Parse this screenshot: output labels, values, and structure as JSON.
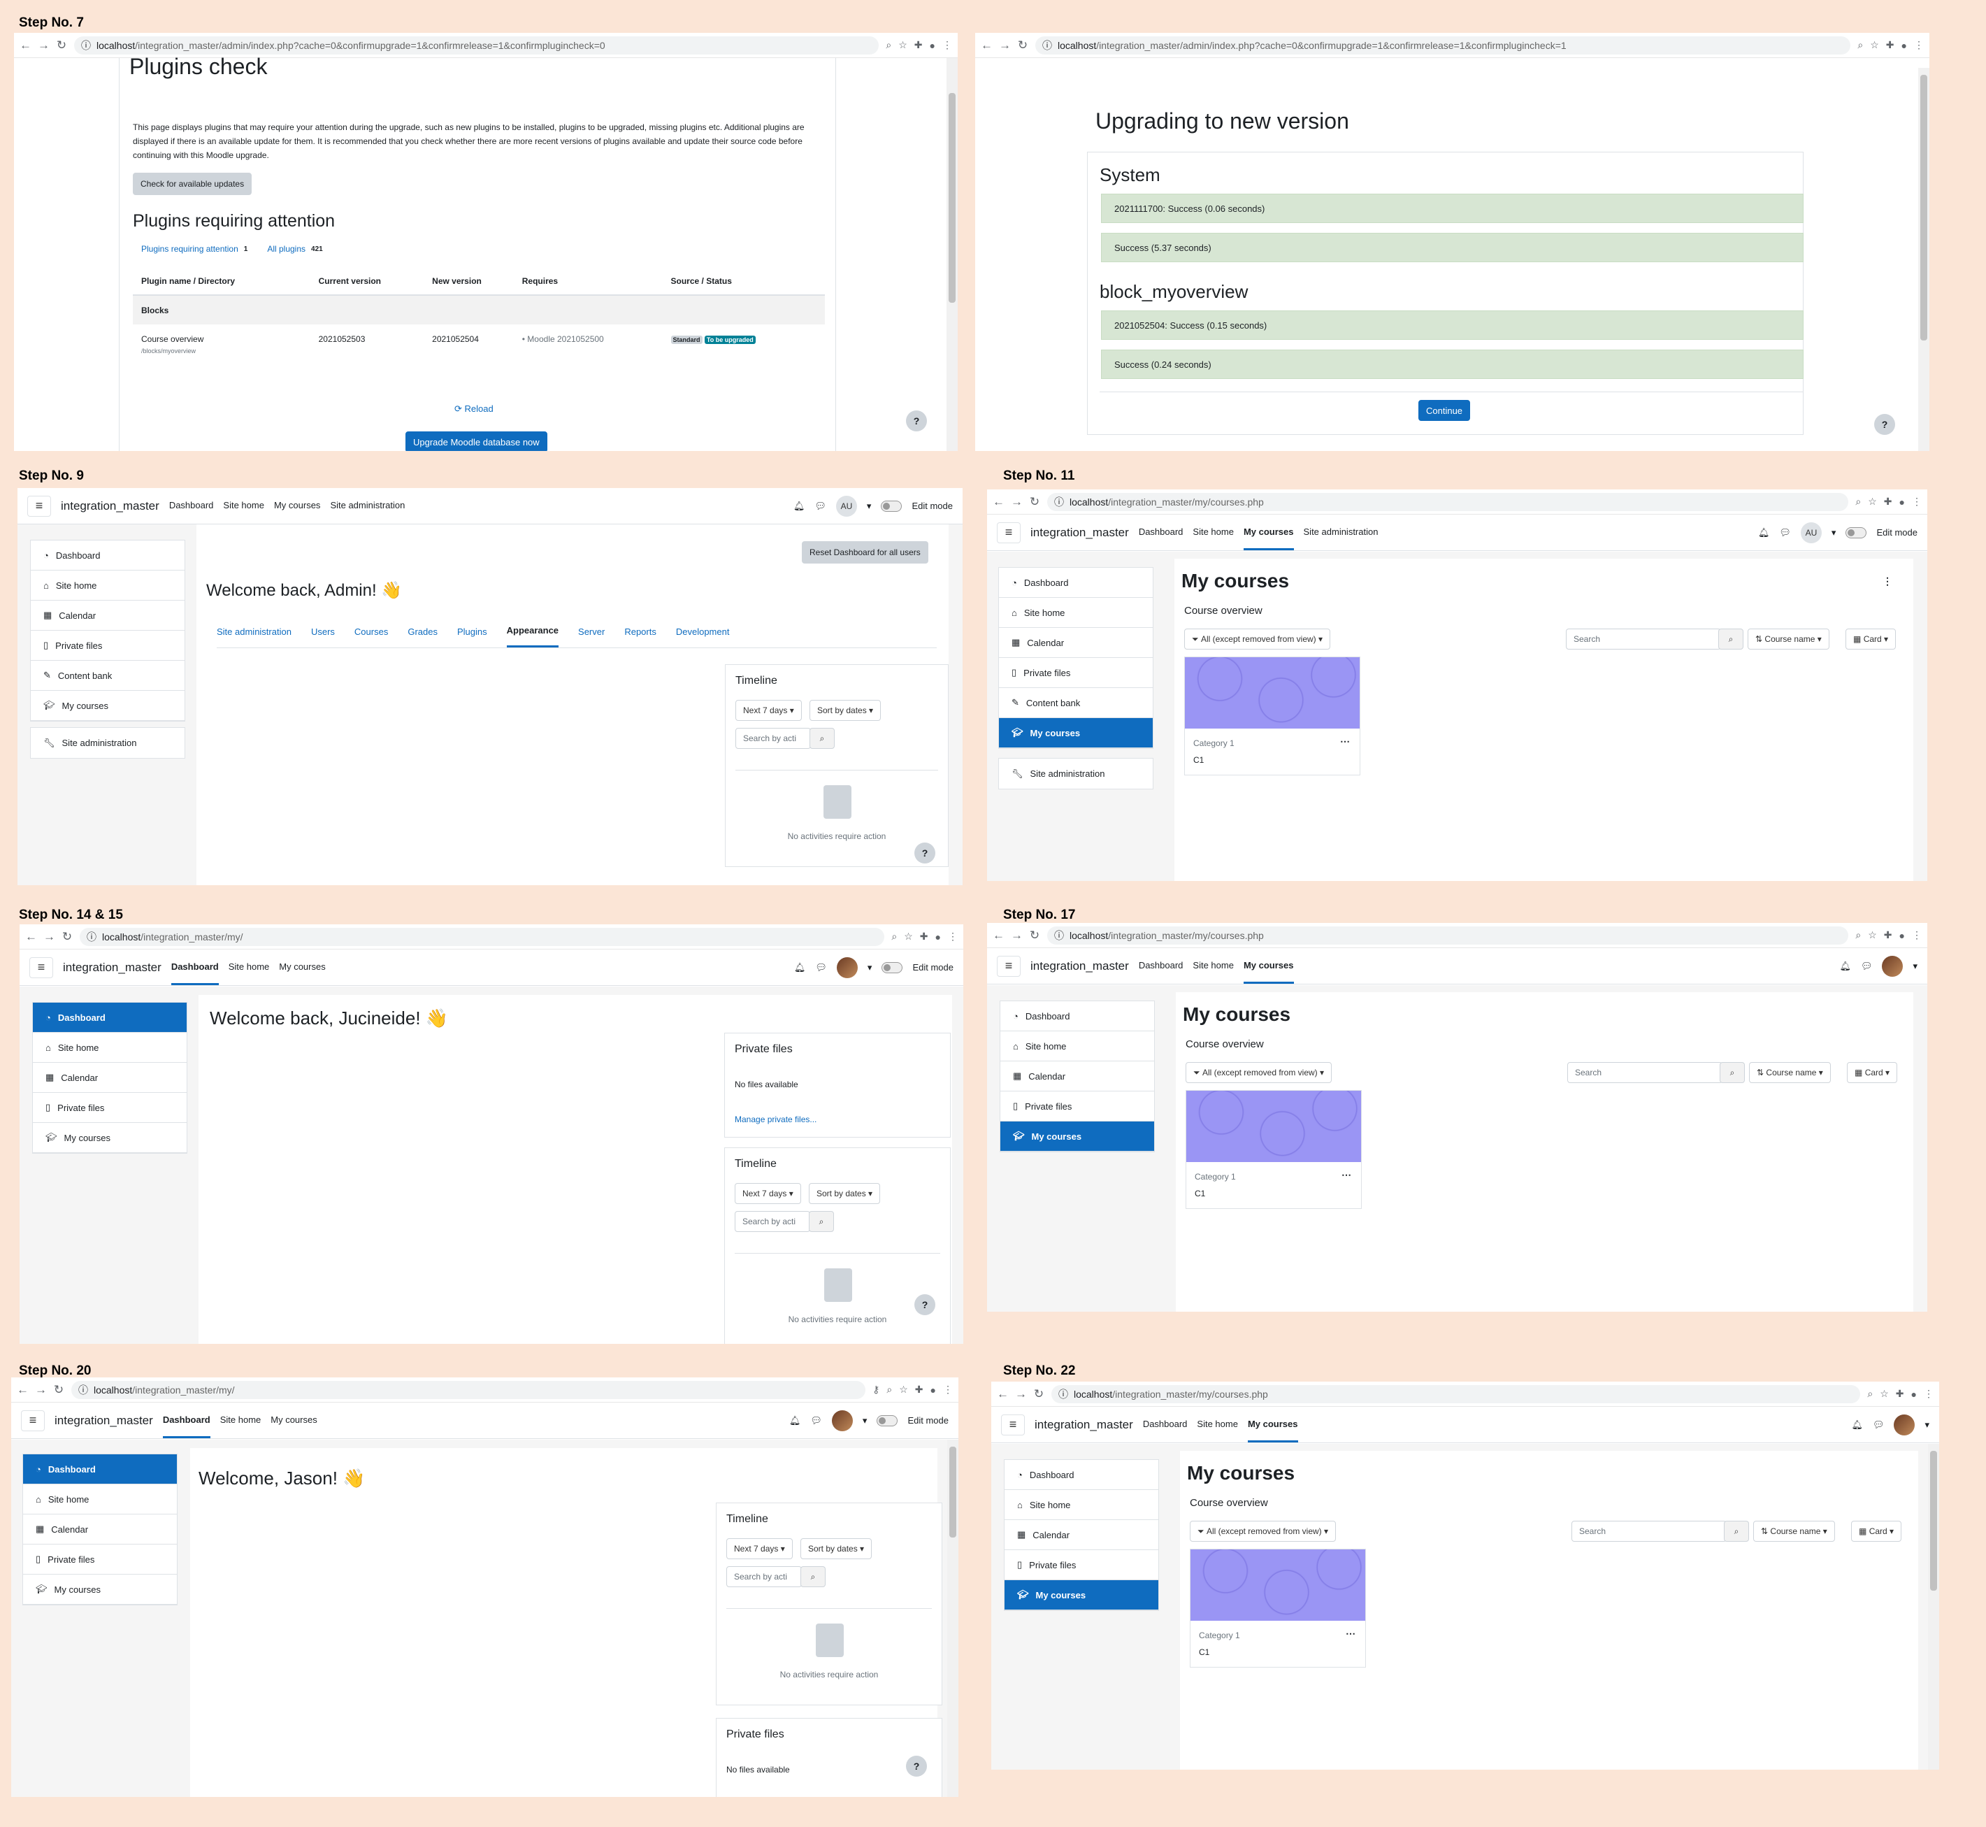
{
  "steps": {
    "s7": "Step No. 7",
    "s9": "Step No. 9",
    "s11": "Step No. 11",
    "s1415": "Step No. 14 & 15",
    "s17": "Step No. 17",
    "s20": "Step No. 20",
    "s22": "Step No. 22"
  },
  "urls": {
    "u7a": "localhost",
    "u7b": "/integration_master/admin/index.php?cache=0&confirmupgrade=1&confirmrelease=1&confirmplugincheck=0",
    "u8a": "localhost",
    "u8b": "/integration_master/admin/index.php?cache=0&confirmupgrade=1&confirmrelease=1&confirmplugincheck=1",
    "u11a": "localhost",
    "u11b": "/integration_master/my/courses.php",
    "u14a": "localhost",
    "u14b": "/integration_master/my/",
    "u17a": "localhost",
    "u17b": "/integration_master/my/courses.php",
    "u20a": "localhost",
    "u20b": "/integration_master/my/",
    "u22a": "localhost",
    "u22b": "/integration_master/my/courses.php"
  },
  "nav": {
    "brand": "integration_master",
    "dashboard": "Dashboard",
    "site_home": "Site home",
    "my_courses": "My courses",
    "site_admin": "Site administration",
    "edit_mode": "Edit mode",
    "avatar_initials": "AU"
  },
  "drawer": {
    "dashboard": "Dashboard",
    "site_home": "Site home",
    "calendar": "Calendar",
    "private_files": "Private files",
    "content_bank": "Content bank",
    "my_courses": "My courses",
    "site_admin": "Site administration"
  },
  "p7": {
    "title": "Plugins check",
    "intro": "This page displays plugins that may require your attention during the upgrade, such as new plugins to be installed, plugins to be upgraded, missing plugins etc. Additional plugins are displayed if there is an available update for them. It is recommended that you check whether there are more recent versions of plugins available and update their source code before continuing with this Moodle upgrade.",
    "check_btn": "Check for available updates",
    "heading": "Plugins requiring attention",
    "tab_attention": "Plugins requiring attention",
    "tab_attention_count": "1",
    "tab_all": "All plugins",
    "tab_all_count": "421",
    "cols": [
      "Plugin name / Directory",
      "Current version",
      "New version",
      "Requires",
      "Source / Status"
    ],
    "group": "Blocks",
    "plugin_name": "Course overview",
    "plugin_dir": "/blocks/myoverview",
    "current": "2021052503",
    "new": "2021052504",
    "requires": "Moodle 2021052500",
    "badge_standard": "Standard",
    "badge_upgrade": "To be upgraded",
    "reload": "Reload",
    "upgrade_btn": "Upgrade Moodle database now"
  },
  "p8": {
    "title": "Upgrading to new version",
    "sys": "System",
    "sys_r1": "2021111700: Success (0.06 seconds)",
    "sys_r2": "Success (5.37 seconds)",
    "blk": "block_myoverview",
    "blk_r1": "2021052504: Success (0.15 seconds)",
    "blk_r2": "Success (0.24 seconds)",
    "continue": "Continue"
  },
  "p9": {
    "reset": "Reset Dashboard for all users",
    "welcome": "Welcome back, Admin! 👋",
    "tabs": [
      "Site administration",
      "Users",
      "Courses",
      "Grades",
      "Plugins",
      "Appearance",
      "Server",
      "Reports",
      "Development"
    ]
  },
  "timeline": {
    "title": "Timeline",
    "next7": "Next 7 days",
    "sort": "Sort by dates",
    "search_ph": "Search by acti",
    "empty": "No activities require action"
  },
  "courses": {
    "title": "My courses",
    "overview": "Course overview",
    "filter": "All (except removed from view)",
    "search_ph": "Search",
    "sortname": "Course name",
    "view": "Card",
    "category": "Category 1",
    "course": "C1"
  },
  "p14": {
    "welcome": "Welcome back, Jucineide! 👋"
  },
  "pf": {
    "title": "Private files",
    "none": "No files available",
    "manage": "Manage private files..."
  },
  "p20": {
    "welcome": "Welcome, Jason! 👋"
  },
  "help": "?"
}
